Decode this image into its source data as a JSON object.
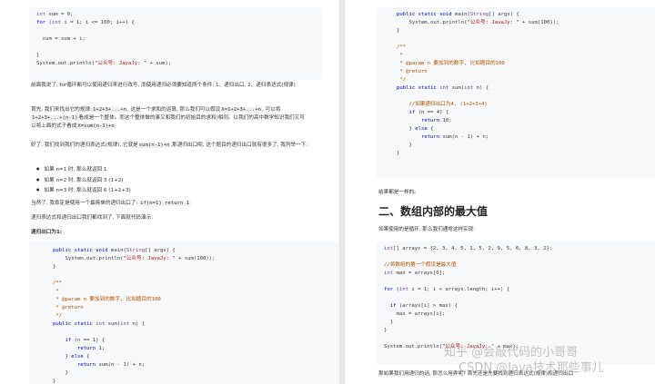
{
  "left": {
    "code1": [
      "int sum = 0;",
      "for (int i = 1; i <= 100; i++) {",
      "",
      "  sum = sum + i;",
      "",
      "}",
      "System.out.println(\"公众号: JavaJy: \" + sum);"
    ],
    "p1": "前面我说了, for循环都可以使用递归来进行改写, 而使用递归必须要知道两个条件: 1、递归出口, 2、递归表达式(规律)",
    "p2_prefix": "首先, 我们来找出它的规律:",
    "p2_code1": "1+2+3+...+n",
    "p2_mid": ", 这是一个求和的运算, 那么我们可以假设",
    "p2_code2": "X=1+2+3+...+n",
    "p2_mid2": ", 可以将",
    "p2_code3": "1+2+3+...+(n-1)",
    "p2_mid3": "看成是一个整体。而这个整体做的事又和我们的初始目的求和)相同。以我们的高中数学知识我们又可以将上面的式子看成",
    "p2_code4": "X=sum(n-1)+n",
    "p3_prefix": "好了, 我们找到我们的递归表达式(规律), 它就是",
    "p3_code": "sum(n-1)+n",
    "p3_suffix": ",那递归出口呢, 这个题目的递归出口就有很多了, 我列举一下:",
    "bullets": [
      "如果 n=1 时, 那么就返回 1",
      "如果 n=2 时, 那么就返回 3 (1+2)",
      "如果 n=3 时, 那么就返回 6 (1+2+3)"
    ],
    "p4_prefix": "当然了, 我肯定是使用一个最简单的递归出口了:",
    "p4_code": "if(n=1) return 1",
    "p5": "递归表达式和递归出口我们都找到了, 下面就代码演示:",
    "p6": "递归出口为1:",
    "code2": [
      "public static void main(String[] args) {",
      "    System.out.println(\"公众号: JavaJy: \" + sum(100));",
      "}",
      "",
      "/**",
      " *",
      " * @param n 要加到的数字, 比如题目的100",
      " * @return",
      " */",
      "public static int sum(int n) {",
      "",
      "    if (n == 1) {",
      "        return 1;",
      "    } else {",
      "        return sum(n - 1) + n;",
      "    }",
      "}"
    ]
  },
  "right": {
    "code1": [
      "public static void main(String[] args) {",
      "    System.out.println(\"公众号: JavaJy: \" + sum(100));",
      "}",
      "",
      "/**",
      " *",
      " * @param n 要加到的数字, 比如题目的100",
      " * @return",
      " */",
      "public static int sum(int n) {",
      "",
      "    //如果递归出口为4, (1+2+3+4)",
      "    if (n == 4) {",
      "        return 10;",
      "    } else {",
      "        return sum(n - 1) + n;",
      "    }",
      "}"
    ],
    "p1": "结果都是一样的。",
    "heading": "二、数组内部的最大值",
    "p2": "如果使用的是循环, 那么我们通常这样实现:",
    "code2": [
      "int[] arrays = {2, 3, 4, 5, 1, 5, 2, 9, 5, 6, 8, 3, 2};",
      "",
      "//将数组的第一个假设是最大值",
      "int max = arrays[0];",
      "",
      "for (int i = 1; i < arrays.length; i++) {",
      "",
      "  if (arrays[i] > max) {",
      "    max = arrays[i];",
      "  }",
      "}",
      "",
      "System.out.println(\"公众号: JavaJy: \" + max);"
    ],
    "p3": "那如果我们用递归的话, 那怎么用弄呢? 首先还是先要找到递归表达式(规律)和递归出口"
  },
  "watermark": {
    "line1": "知乎 @会敲代码的小哥哥",
    "line2": "CSDN @Java技术那些事儿"
  }
}
